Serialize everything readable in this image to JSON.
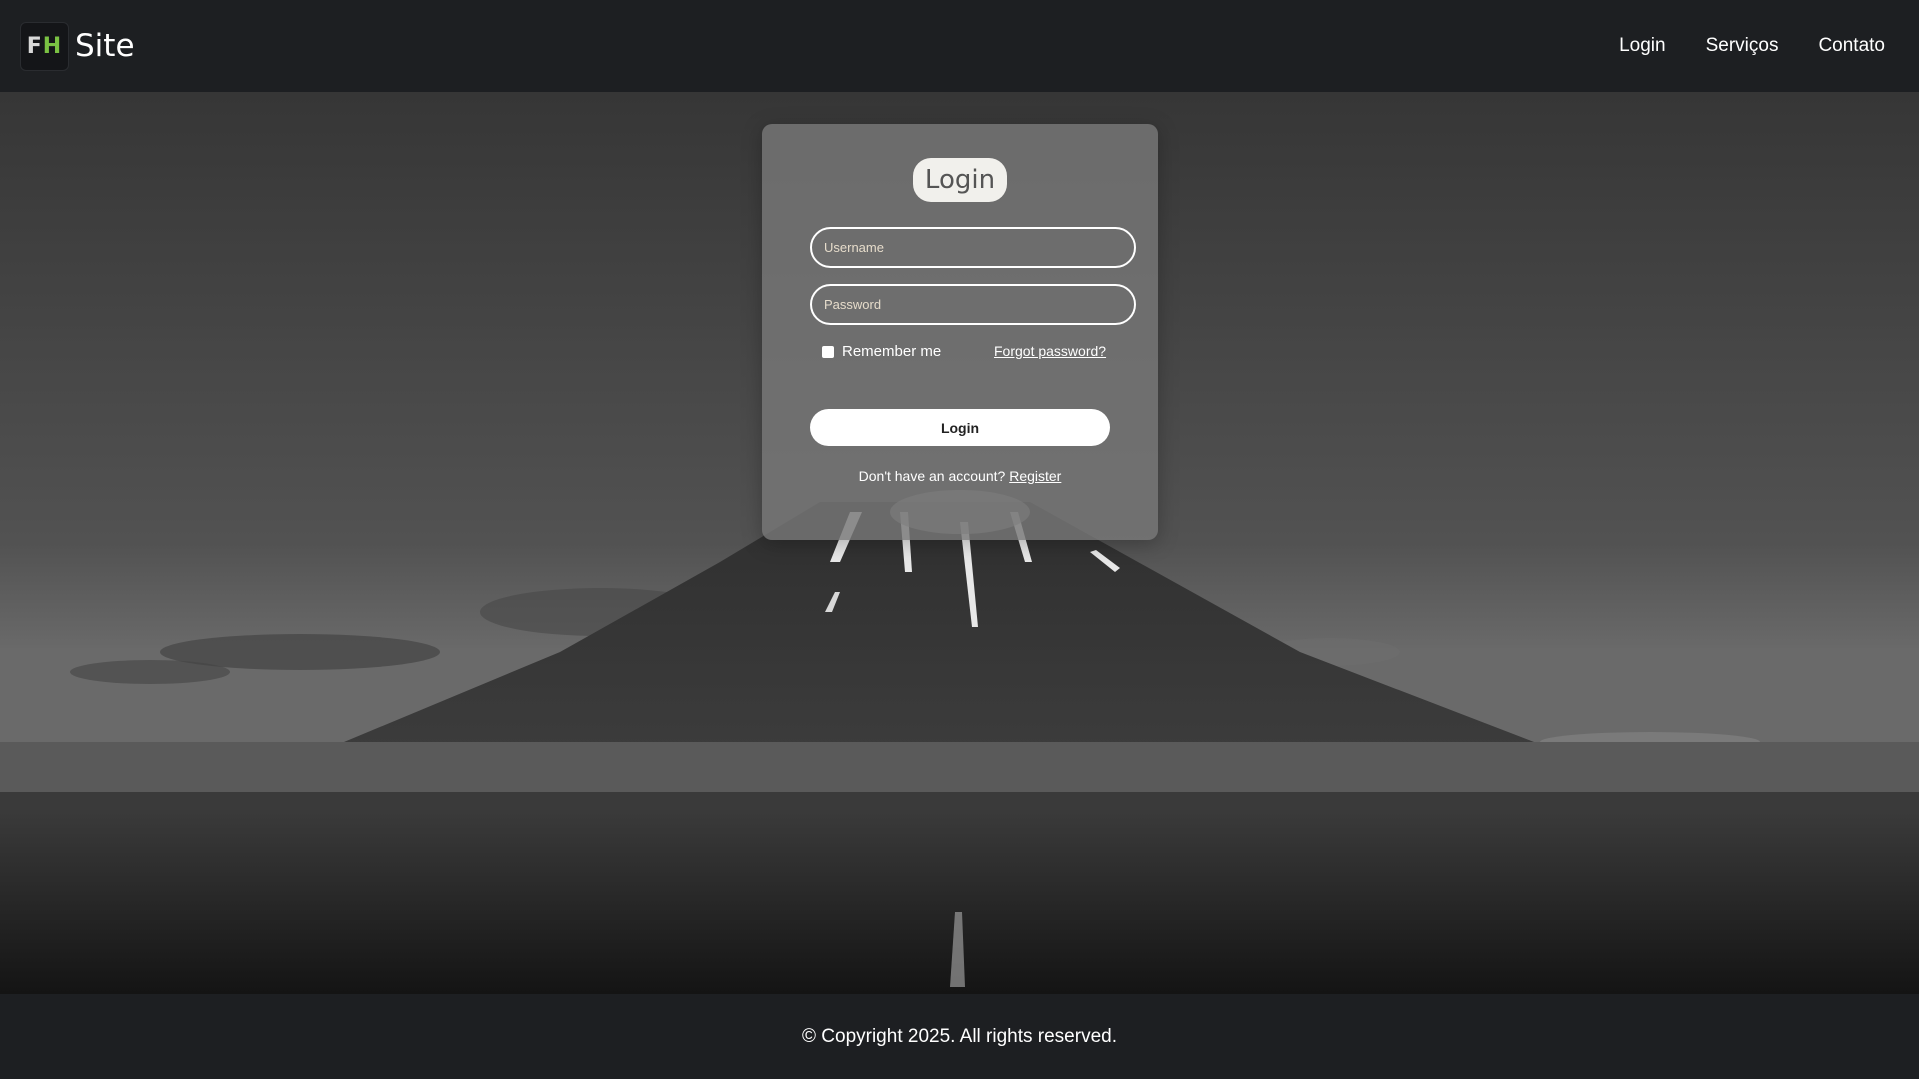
{
  "header": {
    "logo_f": "F",
    "logo_h": "H",
    "site_name": "Site",
    "nav": [
      {
        "label": "Login"
      },
      {
        "label": "Serviços"
      },
      {
        "label": "Contato"
      }
    ]
  },
  "login_card": {
    "title": "Login",
    "username_placeholder": "Username",
    "password_placeholder": "Password",
    "remember_label": "Remember me",
    "forgot_label": "Forgot password?",
    "submit_label": "Login",
    "register_prompt": "Don't have an account?",
    "register_link": "Register"
  },
  "footer": {
    "copyright": "© Copyright 2025. All rights reserved."
  },
  "colors": {
    "header_bg": "#1d1f22",
    "accent_green": "#7ac143",
    "card_bg": "rgba(120,120,120,0.82)"
  }
}
